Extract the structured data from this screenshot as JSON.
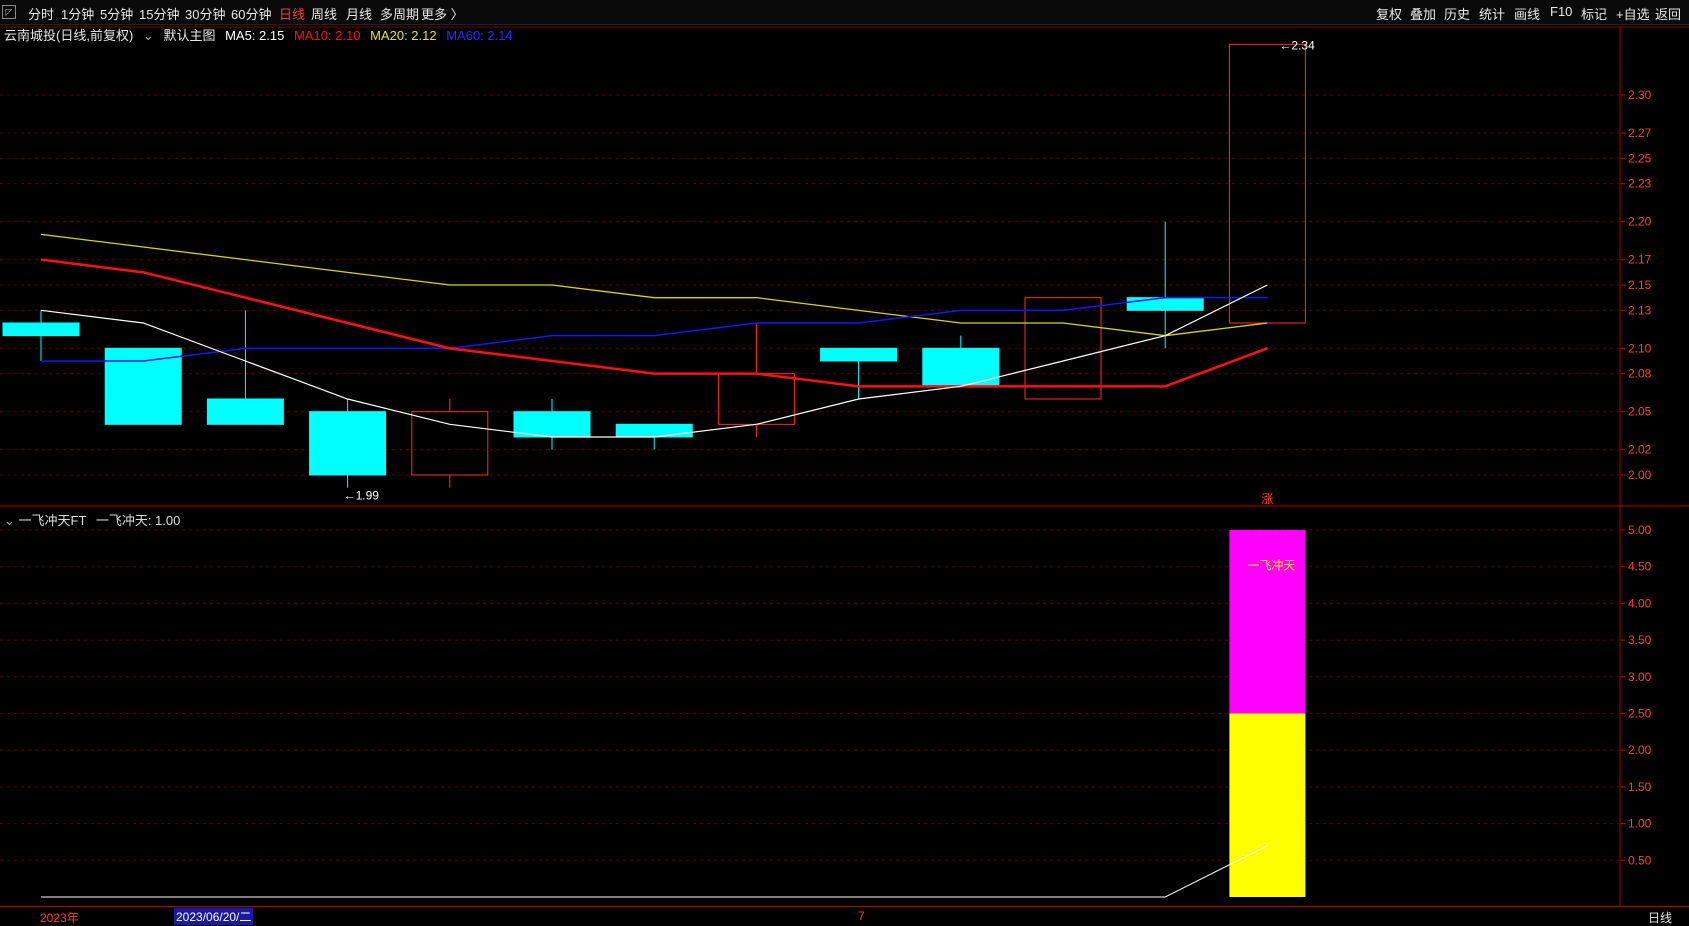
{
  "toolbar": {
    "left": [
      "分时",
      "1分钟",
      "5分钟",
      "15分钟",
      "30分钟",
      "60分钟",
      "日线",
      "周线",
      "月线",
      "多周期",
      "更多 〉"
    ],
    "active": "日线",
    "right": [
      "复权",
      "叠加",
      "历史",
      "统计",
      "画线",
      "F10",
      "标记",
      "+自选",
      "返回"
    ]
  },
  "legend": {
    "stock": "云南城投(日线,前复权)",
    "main": "默认主图",
    "ma5": "MA5: 2.15",
    "ma10": "MA10: 2.10",
    "ma20": "MA20: 2.12",
    "ma60": "MA60: 2.14"
  },
  "legend2": {
    "name": "一飞冲天FT",
    "value": "一飞冲天: 1.00"
  },
  "status": {
    "year": "2023年",
    "date": "2023/06/20/二",
    "month": "7",
    "period": "日线"
  },
  "colors": {
    "up": "#ff2b2b",
    "down": "#00ffff",
    "ma5": "#ffffff",
    "ma10": "#ff1010",
    "ma20": "#d8d800",
    "ma60": "#1515ff",
    "magenta": "#ff00ff",
    "yellow": "#ffff00"
  },
  "chart_data": [
    {
      "type": "candlestick",
      "ylim": [
        1.95,
        2.36
      ],
      "yticks": [
        2.0,
        2.02,
        2.05,
        2.08,
        2.1,
        2.13,
        2.15,
        2.17,
        2.2,
        2.23,
        2.25,
        2.27,
        2.3
      ],
      "candles": [
        {
          "o": 2.11,
          "h": 2.13,
          "l": 2.09,
          "c": 2.12,
          "dir": "down"
        },
        {
          "o": 2.1,
          "h": 2.1,
          "l": 2.04,
          "c": 2.04,
          "dir": "down"
        },
        {
          "o": 2.06,
          "h": 2.13,
          "l": 2.04,
          "c": 2.04,
          "dir": "down"
        },
        {
          "o": 2.05,
          "h": 2.06,
          "l": 1.99,
          "c": 2.0,
          "dir": "down"
        },
        {
          "o": 2.0,
          "h": 2.06,
          "l": 1.99,
          "c": 2.05,
          "dir": "up"
        },
        {
          "o": 2.05,
          "h": 2.06,
          "l": 2.02,
          "c": 2.03,
          "dir": "down"
        },
        {
          "o": 2.04,
          "h": 2.04,
          "l": 2.02,
          "c": 2.03,
          "dir": "down"
        },
        {
          "o": 2.04,
          "h": 2.12,
          "l": 2.03,
          "c": 2.08,
          "dir": "up"
        },
        {
          "o": 2.1,
          "h": 2.1,
          "l": 2.06,
          "c": 2.09,
          "dir": "down"
        },
        {
          "o": 2.1,
          "h": 2.11,
          "l": 2.07,
          "c": 2.07,
          "dir": "down"
        },
        {
          "o": 2.06,
          "h": 2.14,
          "l": 2.06,
          "c": 2.14,
          "dir": "up"
        },
        {
          "o": 2.14,
          "h": 2.2,
          "l": 2.1,
          "c": 2.13,
          "dir": "down"
        },
        {
          "o": 2.12,
          "h": 2.34,
          "l": 2.12,
          "c": 2.34,
          "dir": "up"
        }
      ],
      "ma5": [
        2.13,
        2.12,
        2.09,
        2.06,
        2.04,
        2.03,
        2.03,
        2.04,
        2.06,
        2.07,
        2.09,
        2.11,
        2.15
      ],
      "ma10": [
        2.17,
        2.16,
        2.14,
        2.12,
        2.1,
        2.09,
        2.08,
        2.08,
        2.07,
        2.07,
        2.07,
        2.07,
        2.1
      ],
      "ma20": [
        2.19,
        2.18,
        2.17,
        2.16,
        2.15,
        2.15,
        2.14,
        2.14,
        2.13,
        2.12,
        2.12,
        2.11,
        2.12
      ],
      "ma60": [
        2.09,
        2.09,
        2.1,
        2.1,
        2.1,
        2.11,
        2.11,
        2.12,
        2.12,
        2.13,
        2.13,
        2.14,
        2.14
      ],
      "annotations": [
        {
          "text": "2.34",
          "i": 12,
          "v": 2.34
        },
        {
          "text": "1.99",
          "i": 3,
          "v": 1.99
        },
        {
          "text": "涨",
          "i": 12
        }
      ]
    },
    {
      "type": "bar",
      "ylim": [
        0,
        5.15
      ],
      "yticks": [
        0.5,
        1.0,
        1.5,
        2.0,
        2.5,
        3.0,
        3.5,
        4.0,
        4.5,
        5.0
      ],
      "bars": [
        {
          "i": 12,
          "lower": 2.5,
          "upper": 5.0
        }
      ],
      "line": [
        0,
        0,
        0,
        0,
        0,
        0,
        0,
        0,
        0,
        0,
        0,
        0,
        0.7
      ],
      "label": "一飞冲天"
    }
  ]
}
